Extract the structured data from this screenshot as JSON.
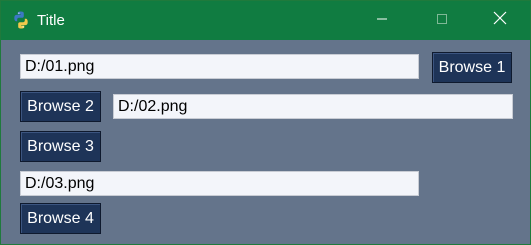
{
  "window": {
    "title": "Title",
    "app_icon": "python-icon",
    "controls": [
      "minimize-icon",
      "maximize-icon",
      "close-icon"
    ],
    "titlebar_color": "#107c41",
    "background_color": "#64748b"
  },
  "rows": {
    "field1": {
      "value": "D:/01.png"
    },
    "browse1": {
      "label": "Browse 1"
    },
    "browse2": {
      "label": "Browse 2"
    },
    "field2": {
      "value": "D:/02.png"
    },
    "browse3": {
      "label": "Browse 3"
    },
    "field3": {
      "value": "D:/03.png"
    },
    "browse4": {
      "label": "Browse 4"
    }
  },
  "colors": {
    "button_bg": "#1e3458",
    "input_bg": "#f3f5fa"
  }
}
